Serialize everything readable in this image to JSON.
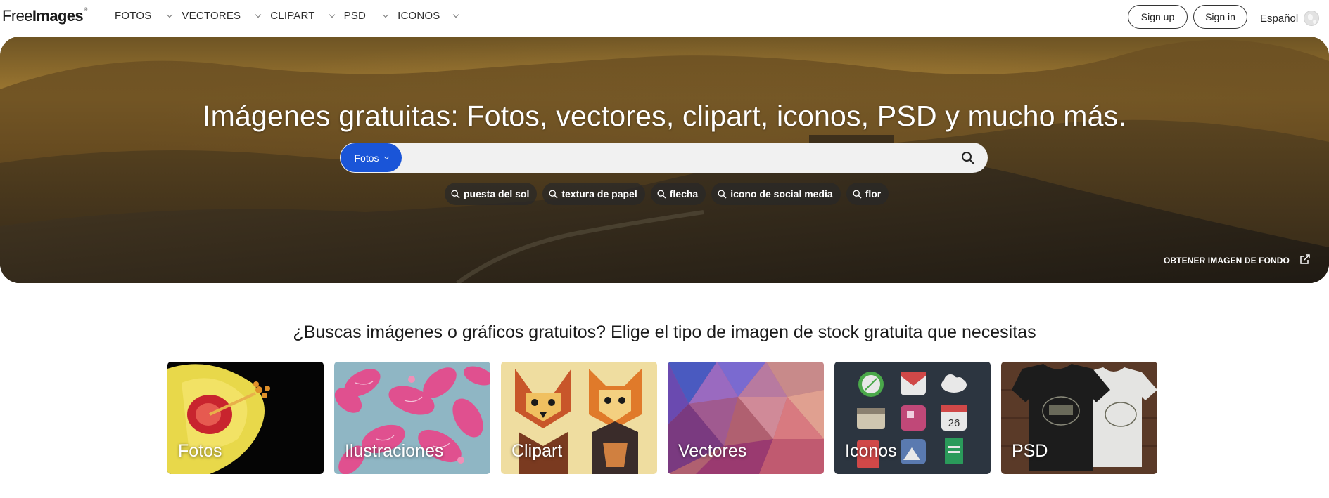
{
  "logo": {
    "part1": "Free",
    "part2": "Images",
    "mark": "®"
  },
  "nav": {
    "items": [
      {
        "label": "FOTOS"
      },
      {
        "label": "VECTORES"
      },
      {
        "label": "CLIPART"
      },
      {
        "label": "PSD"
      },
      {
        "label": "ICONOS"
      }
    ],
    "signup": "Sign up",
    "signin": "Sign in",
    "language": "Español"
  },
  "hero": {
    "title": "Imágenes gratuitas: Fotos, vectores, clipart, iconos, PSD y mucho más.",
    "search_type": "Fotos",
    "search_value": "",
    "tags": [
      "puesta del sol",
      "textura de papel",
      "flecha",
      "icono de social media",
      "flor"
    ],
    "get_background": "OBTENER IMAGEN DE FONDO"
  },
  "section": {
    "title": "¿Buscas imágenes o gráficos gratuitos? Elige el tipo de imagen de stock gratuita que necesitas",
    "cards": [
      {
        "label": "Fotos"
      },
      {
        "label": "Ilustraciones"
      },
      {
        "label": "Clipart"
      },
      {
        "label": "Vectores"
      },
      {
        "label": "Iconos"
      },
      {
        "label": "PSD"
      }
    ],
    "icons_card_date": "26"
  },
  "colors": {
    "accent_blue": "#1a55d8",
    "tag_bg": "#282828"
  }
}
